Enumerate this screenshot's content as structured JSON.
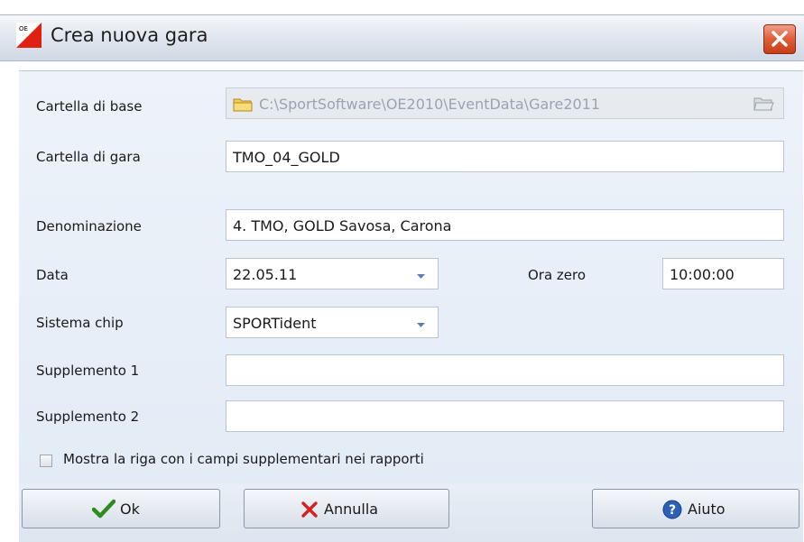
{
  "window": {
    "title": "Crea nuova gara",
    "app_icon": "orienteering-flag-icon",
    "app_icon_text": "OE",
    "close_icon": "close-icon"
  },
  "form": {
    "base_folder": {
      "label": "Cartella di base",
      "value": "C:\\SportSoftware\\OE2010\\EventData\\Gare2011",
      "disabled": true,
      "icon": "folder-icon",
      "button_icon": "browse-folder-icon"
    },
    "event_folder": {
      "label": "Cartella di gara",
      "value": "TMO_04_GOLD"
    },
    "name": {
      "label": "Denominazione",
      "value": "4. TMO, GOLD Savosa, Carona"
    },
    "date": {
      "label": "Data",
      "value": "22.05.11"
    },
    "zero_time": {
      "label": "Ora zero",
      "value": "10:00:00"
    },
    "chip_system": {
      "label": "Sistema chip",
      "value": "SPORTident"
    },
    "supplement1": {
      "label": "Supplemento 1",
      "value": ""
    },
    "supplement2": {
      "label": "Supplemento 2",
      "value": ""
    },
    "show_supplement_row": {
      "label": "Mostra la riga con i campi supplementari nei rapporti",
      "checked": false
    }
  },
  "buttons": {
    "ok": {
      "label": "Ok",
      "icon": "checkmark-icon"
    },
    "cancel": {
      "label": "Annulla",
      "icon": "x-icon"
    },
    "help": {
      "label": "Aiuto",
      "icon": "help-icon"
    }
  },
  "colors": {
    "close_red": "#d9502a",
    "ok_green": "#2e8b1e",
    "cancel_red": "#d42020",
    "help_blue": "#2b5fb8",
    "folder_yellow": "#e8b830"
  }
}
